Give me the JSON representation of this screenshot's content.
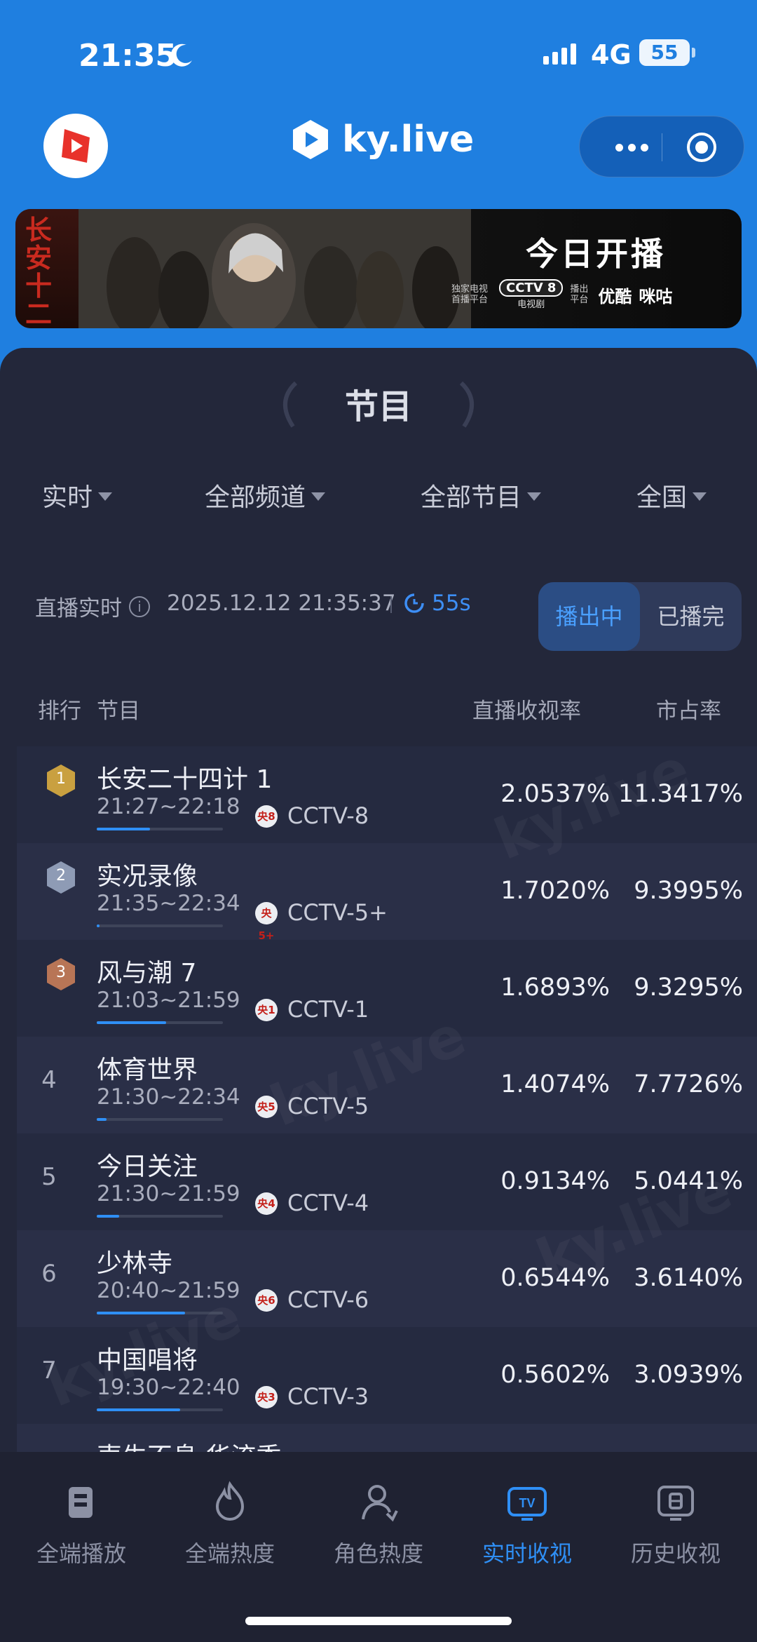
{
  "status_bar": {
    "time": "21:35",
    "network": "4G",
    "battery": "55"
  },
  "header": {
    "brand": "ky.live"
  },
  "banner": {
    "poster_title": "长安十二时",
    "headline": "今日开播",
    "exclusive": "独家电视首播平台",
    "cctv": "CCTV 8",
    "cctv_sub": "电视剧",
    "stream": "播出平台",
    "partner_1": "优酷",
    "partner_2": "咪咕"
  },
  "panel": {
    "title": "节目"
  },
  "filters": [
    {
      "label": "实时"
    },
    {
      "label": "全部频道"
    },
    {
      "label": "全部节目"
    },
    {
      "label": "全国"
    }
  ],
  "live": {
    "label": "直播实时",
    "datetime": "2025.12.12  21:35:37",
    "countdown": "55s",
    "toggle_on": "播出中",
    "toggle_off": "已播完"
  },
  "table": {
    "headers": {
      "rank": "排行",
      "program": "节目",
      "rating": "直播收视率",
      "share": "市占率"
    },
    "rows": [
      {
        "rank": "1",
        "name": "长安二十四计 1",
        "time": "21:27~22:18",
        "channel_logo": "央8",
        "channel": "CCTV-8",
        "rating": "2.0537%",
        "share": "11.3417%",
        "progress": 0.42
      },
      {
        "rank": "2",
        "name": "实况录像",
        "time": "21:35~22:34",
        "channel_logo": "央5+",
        "channel": "CCTV-5+",
        "rating": "1.7020%",
        "share": "9.3995%",
        "progress": 0.02
      },
      {
        "rank": "3",
        "name": "风与潮 7",
        "time": "21:03~21:59",
        "channel_logo": "央1",
        "channel": "CCTV-1",
        "rating": "1.6893%",
        "share": "9.3295%",
        "progress": 0.55
      },
      {
        "rank": "4",
        "name": "体育世界",
        "time": "21:30~22:34",
        "channel_logo": "央5",
        "channel": "CCTV-5",
        "rating": "1.4074%",
        "share": "7.7726%",
        "progress": 0.08
      },
      {
        "rank": "5",
        "name": "今日关注",
        "time": "21:30~21:59",
        "channel_logo": "央4",
        "channel": "CCTV-4",
        "rating": "0.9134%",
        "share": "5.0441%",
        "progress": 0.18
      },
      {
        "rank": "6",
        "name": "少林寺",
        "time": "20:40~21:59",
        "channel_logo": "央6",
        "channel": "CCTV-6",
        "rating": "0.6544%",
        "share": "3.6140%",
        "progress": 0.7
      },
      {
        "rank": "7",
        "name": "中国唱将",
        "time": "19:30~22:40",
        "channel_logo": "央3",
        "channel": "CCTV-3",
        "rating": "0.5602%",
        "share": "3.0939%",
        "progress": 0.66
      },
      {
        "rank": "8",
        "name": "声生不息·华流季",
        "time": "",
        "channel_logo": "",
        "channel": "",
        "rating": "",
        "share": "",
        "progress": 0
      }
    ]
  },
  "watermark": "ky.live",
  "bottom_nav": [
    {
      "label": "全端播放",
      "icon": "play-doc-icon",
      "active": false
    },
    {
      "label": "全端热度",
      "icon": "flame-icon",
      "active": false
    },
    {
      "label": "角色热度",
      "icon": "person-icon",
      "active": false
    },
    {
      "label": "实时收视",
      "icon": "tv-icon",
      "active": true
    },
    {
      "label": "历史收视",
      "icon": "history-tv-icon",
      "active": false
    }
  ],
  "colors": {
    "primary": "#1f7fe0",
    "accent": "#2f8ff5",
    "panel": "#23273a",
    "gold": "#c9a040",
    "silver": "#8e9bb5",
    "bronze": "#b87556"
  }
}
